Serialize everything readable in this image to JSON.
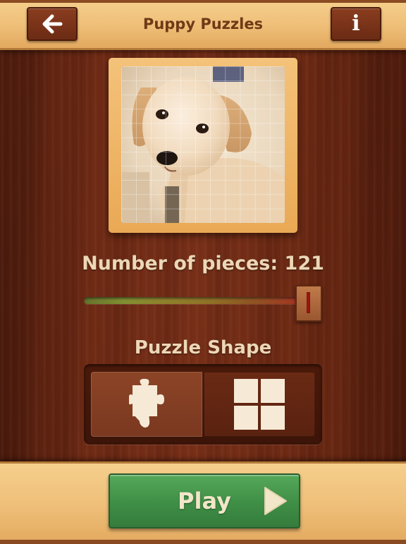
{
  "header": {
    "title": "Puppy Puzzles",
    "back_icon": "arrow-left-icon",
    "info_label": "i"
  },
  "preview": {
    "image": "puppy-photo",
    "grid": "11x11"
  },
  "pieces": {
    "label": "Number of pieces: 121",
    "count": 121,
    "slider_fraction": 1.0
  },
  "shape": {
    "label": "Puzzle Shape",
    "options": [
      {
        "name": "jigsaw",
        "icon": "jigsaw-piece-icon",
        "selected": true
      },
      {
        "name": "square",
        "icon": "square-grid-icon",
        "selected": false
      }
    ]
  },
  "play": {
    "label": "Play",
    "icon": "play-arrow-icon",
    "color": "#4a9a50"
  },
  "colors": {
    "wood_panel": "#efc07a",
    "wood_dark": "#6e2a14",
    "text_light": "#ecd7b6",
    "title_text": "#6e3a16"
  }
}
